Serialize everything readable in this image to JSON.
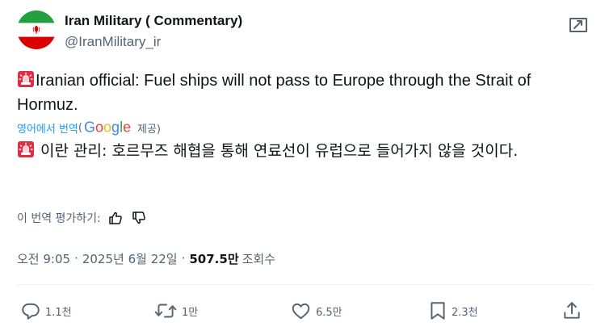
{
  "author": {
    "display_name": "Iran Military ( Commentary)",
    "handle": "@IranMilitary_ir"
  },
  "tweet": {
    "text": "Iranian official: Fuel ships will not pass to Europe through the Strait of Hormuz.",
    "translate_link": "영어에서 번역",
    "translate_open_paren": "(",
    "translate_provider": "Google",
    "translate_provided_by": "제공)",
    "translated_text": "이란 관리: 호르무즈 해협을 통해 연료선이 유럽으로 들어가지 않을 것이다.",
    "rate_translation_label": "이 번역 평가하기:"
  },
  "meta": {
    "time": "오전 9:05",
    "separator": "·",
    "date": "2025년 6월 22일",
    "views_count": "507.5만",
    "views_label": "조회수"
  },
  "actions": {
    "replies": "1.1천",
    "reposts": "1만",
    "likes": "6.5만",
    "bookmarks": "2.3천"
  },
  "icons": {
    "emoji": "rotating-light-emoji",
    "avatar": "iran-flag-avatar"
  },
  "colors": {
    "text_primary": "#0f1419",
    "text_secondary": "#536471",
    "link_blue": "#1d9bf0",
    "flag_green": "#239f40",
    "flag_red": "#da0000",
    "emoji_red": "#dd2e44"
  }
}
